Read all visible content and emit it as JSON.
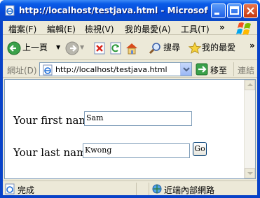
{
  "window": {
    "title": "http://localhost/testjava.html - Microsoft Inter..."
  },
  "menu": {
    "items": [
      "檔案(F)",
      "編輯(E)",
      "檢視(V)",
      "我的最愛(A)",
      "工具(T)"
    ],
    "overflow": "»"
  },
  "toolbar": {
    "back_label": "上一頁",
    "search_label": "搜尋",
    "favorites_label": "我的最愛",
    "overflow": "»"
  },
  "address": {
    "label": "網址(D)",
    "url": "http://localhost/testjava.html",
    "go_label": "移至",
    "links_label": "連結"
  },
  "form": {
    "first_name_label": "Your first name:",
    "first_name_value": "Sam",
    "last_name_label": "Your last name:",
    "last_name_value": "Kwong",
    "submit_label": "Go"
  },
  "status": {
    "text": "完成",
    "zone": "近端內部網路"
  }
}
